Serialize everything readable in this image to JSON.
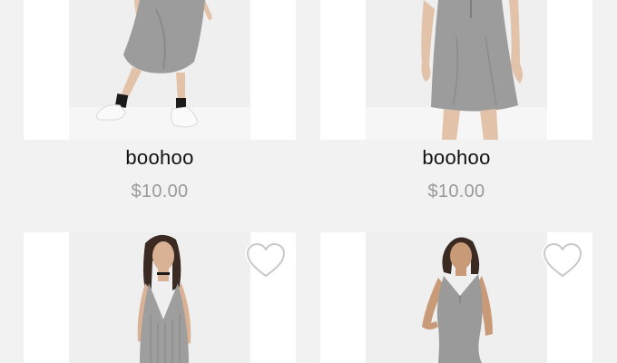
{
  "products": [
    {
      "brand": "boohoo",
      "price": "$10.00",
      "image": "grey-midi-dress-model",
      "wishlist_icon": ""
    },
    {
      "brand": "boohoo",
      "price": "$10.00",
      "image": "grey-swing-dress-model",
      "wishlist_icon": ""
    },
    {
      "brand": "",
      "price": "",
      "image": "grey-plisse-slip-dress-model",
      "wishlist_icon": "heart-outline-icon"
    },
    {
      "brand": "",
      "price": "",
      "image": "grey-bodycon-dress-model",
      "wishlist_icon": "heart-outline-icon"
    }
  ],
  "colors": {
    "background": "#f2f2f2",
    "card": "#ffffff",
    "photo_backdrop": "#efefef",
    "dress": "#9c9c9c",
    "brand_text": "#111111",
    "price_text": "#9a9a9a",
    "heart": "#c8c8c8"
  }
}
